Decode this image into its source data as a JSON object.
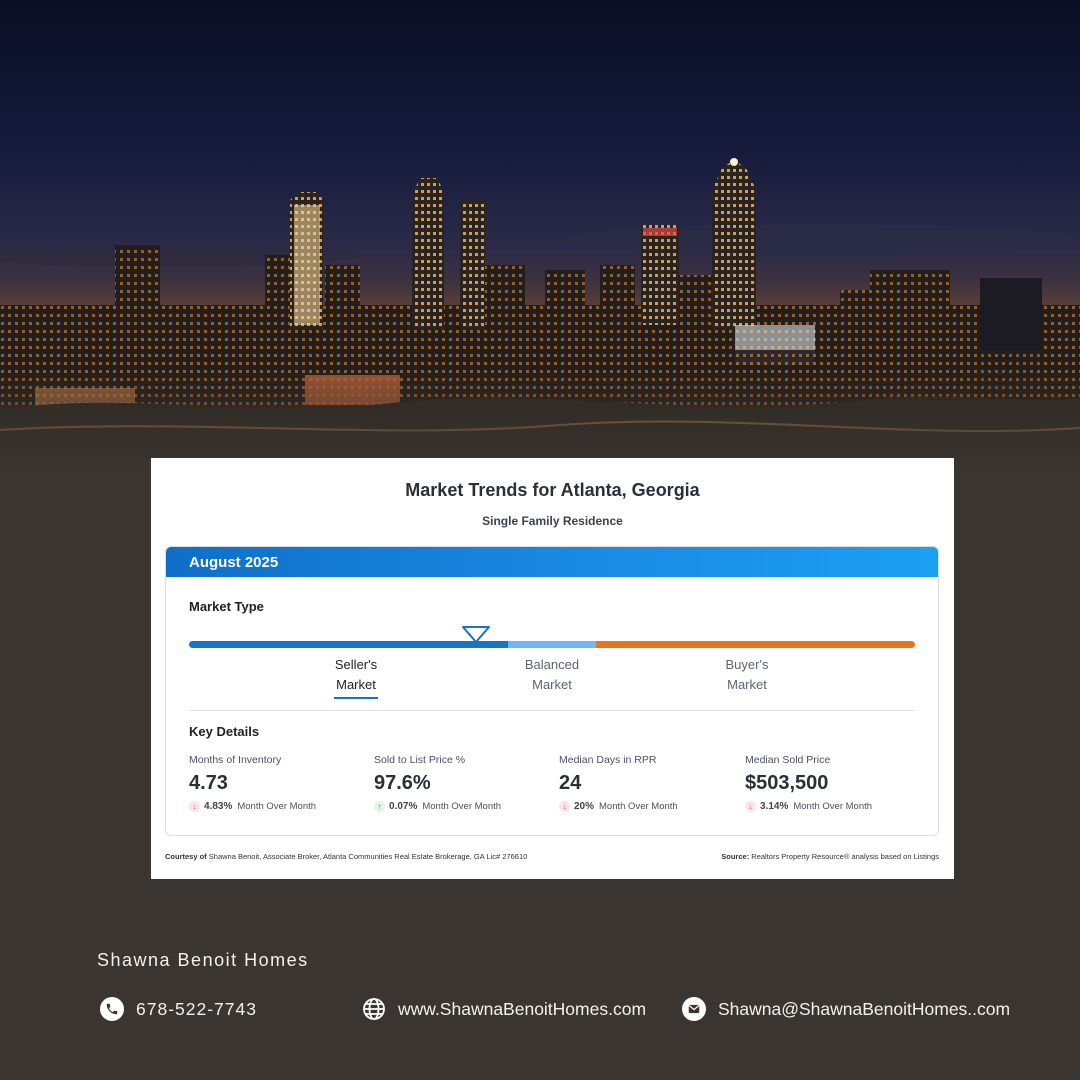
{
  "colors": {
    "background": "#3a3530",
    "header_blue": "#1a72c4",
    "seller_segment": "#1a72c4",
    "balanced_segment": "#6fb6f2",
    "buyer_segment": "#e4741f",
    "down_red": "#d9534f",
    "up_green": "#2e9a4a"
  },
  "hero": {
    "image": "atlanta-skyline-night"
  },
  "card": {
    "title": "Market Trends for Atlanta, Georgia",
    "subtitle": "Single Family Residence",
    "period": "August 2025",
    "market_type": {
      "label": "Market Type",
      "indicator_position": 0.44,
      "options": [
        {
          "line1": "Seller's",
          "line2": "Market",
          "selected": true
        },
        {
          "line1": "Balanced",
          "line2": "Market",
          "selected": false
        },
        {
          "line1": "Buyer's",
          "line2": "Market",
          "selected": false
        }
      ]
    },
    "key_details": {
      "label": "Key Details",
      "metrics": [
        {
          "label": "Months of Inventory",
          "value": "4.73",
          "direction": "down",
          "direction_icon": "↓",
          "change": "4.83%",
          "change_label": "Month Over Month"
        },
        {
          "label": "Sold to List Price %",
          "value": "97.6%",
          "direction": "up",
          "direction_icon": "↑",
          "change": "0.07%",
          "change_label": "Month Over Month"
        },
        {
          "label": "Median Days in RPR",
          "value": "24",
          "direction": "down",
          "direction_icon": "↓",
          "change": "20%",
          "change_label": "Month Over Month"
        },
        {
          "label": "Median Sold Price",
          "value": "$503,500",
          "direction": "down",
          "direction_icon": "↓",
          "change": "3.14%",
          "change_label": "Month Over Month"
        }
      ]
    },
    "courtesy": {
      "prefix": "Courtesy of",
      "text": "Shawna Benoit, Associate Broker, Atlanta Communities Real Estate Brokerage, GA Lic# 276610"
    },
    "source": {
      "prefix": "Source:",
      "text": "Realtors Property Resource® analysis based on Listings"
    }
  },
  "footer": {
    "brand": "Shawna Benoit Homes",
    "phone": "678-522-7743",
    "website": "www.ShawnaBenoitHomes.com",
    "email": "Shawna@ShawnaBenoitHomes..com",
    "icons": [
      "phone-icon",
      "globe-icon",
      "mail-icon"
    ]
  }
}
